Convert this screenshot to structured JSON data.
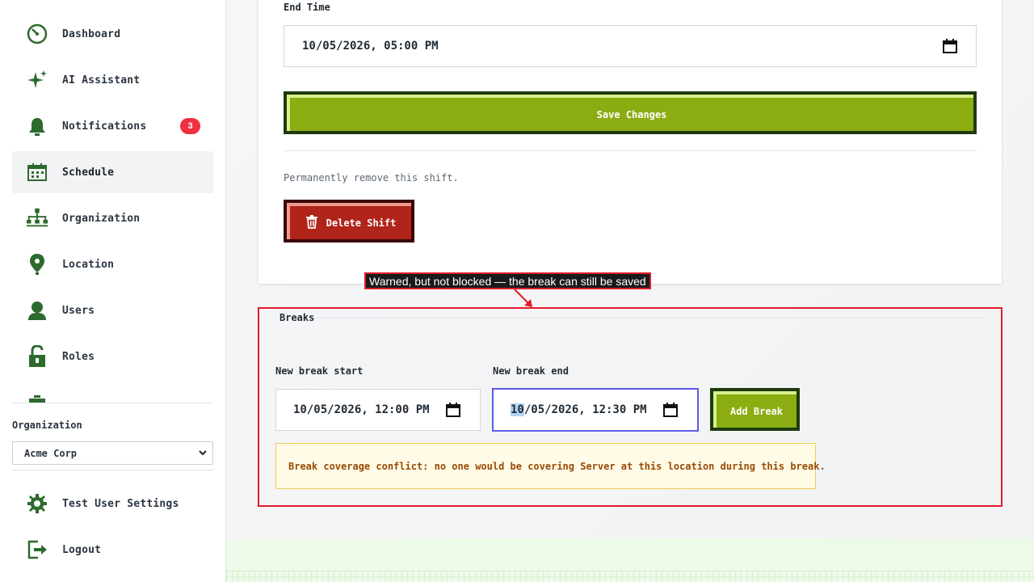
{
  "sidebar": {
    "items": [
      {
        "label": "Dashboard",
        "icon": "dashboard-gauge-icon"
      },
      {
        "label": "AI Assistant",
        "icon": "sparkle-icon"
      },
      {
        "label": "Notifications",
        "icon": "bell-icon",
        "badge": "3"
      },
      {
        "label": "Schedule",
        "icon": "calendar-icon",
        "active": true
      },
      {
        "label": "Organization",
        "icon": "org-chart-icon"
      },
      {
        "label": "Location",
        "icon": "location-pin-icon"
      },
      {
        "label": "Users",
        "icon": "user-icon"
      },
      {
        "label": "Roles",
        "icon": "lock-icon"
      }
    ],
    "organization_label": "Organization",
    "organization_value": "Acme Corp",
    "settings_label": "Test User Settings",
    "logout_label": "Logout"
  },
  "shift_form": {
    "end_time_label": "End Time",
    "end_time_value": "10/05/2026, 05:00 PM",
    "save_label": "Save Changes",
    "remove_text": "Permanently remove this shift.",
    "delete_label": "Delete Shift"
  },
  "annotation": {
    "callout": "Warned, but not blocked — the break can still be saved"
  },
  "breaks": {
    "title": "Breaks",
    "start_label": "New break start",
    "start_value": "10/05/2026, 12:00 PM",
    "end_label": "New break end",
    "end_value_selected": "10",
    "end_value_rest": "/05/2026, 12:30 PM",
    "add_label": "Add Break",
    "warning": "Break coverage conflict: no one would be covering Server at this location during this break."
  },
  "colors": {
    "brand_green": "#8bad12",
    "brand_dark": "#1e3a0c",
    "danger": "#b0241a",
    "badge_red": "#f03040",
    "annotation_red": "#e11d2a",
    "warning_bg": "#fffbe6"
  }
}
